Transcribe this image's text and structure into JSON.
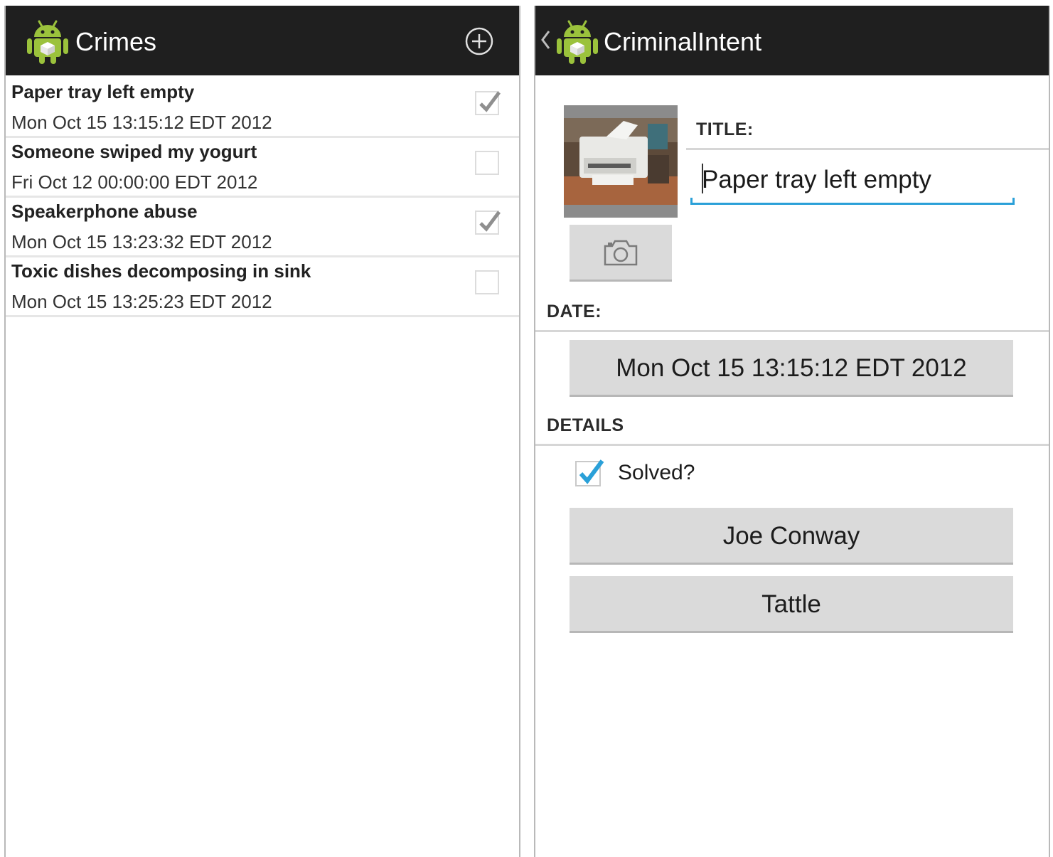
{
  "list_screen": {
    "title": "Crimes",
    "add_icon": "plus-circle-icon",
    "crimes": [
      {
        "title": "Paper tray left empty",
        "date": "Mon Oct 15 13:15:12 EDT 2012",
        "solved": true
      },
      {
        "title": "Someone swiped my yogurt",
        "date": "Fri Oct 12 00:00:00 EDT 2012",
        "solved": false
      },
      {
        "title": "Speakerphone abuse",
        "date": "Mon Oct 15 13:23:32 EDT 2012",
        "solved": true
      },
      {
        "title": "Toxic dishes decomposing in sink",
        "date": "Mon Oct 15 13:25:23 EDT 2012",
        "solved": false
      }
    ]
  },
  "detail_screen": {
    "title": "CriminalIntent",
    "up_icon": "chevron-left-icon",
    "photo_icon": "printer-photo",
    "camera_icon": "camera-icon",
    "title_label": "TITLE:",
    "title_value": "Paper tray left empty",
    "date_label": "DATE:",
    "date_button": "Mon Oct 15 13:15:12 EDT 2012",
    "details_label": "DETAILS",
    "solved_label": "Solved?",
    "solved": true,
    "suspect_button": "Joe Conway",
    "report_button": "Tattle"
  },
  "colors": {
    "action_bar": "#1f1f1f",
    "android_green": "#9bc23c",
    "accent_blue": "#2aa0d8",
    "button_gray": "#dadada"
  }
}
